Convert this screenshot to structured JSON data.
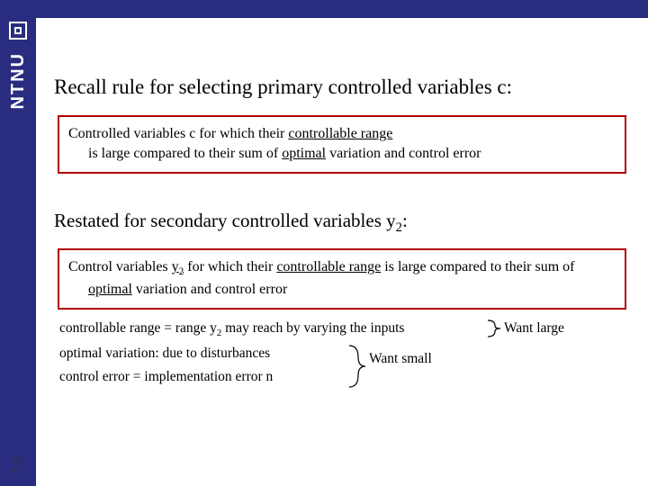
{
  "sidebar": {
    "org": "NTNU"
  },
  "slide": {
    "title_pre": "Recall rule for selecting primary controlled variables c:",
    "box1_a": "Controlled variables c for which their ",
    "box1_b": "controllable range",
    "box1_c": " is large compared to their sum of ",
    "box1_d": "optimal",
    "box1_e": " variation and control error",
    "subtitle_pre": "Restated for secondary controlled variables y",
    "subtitle_sub": "2",
    "subtitle_post": ":",
    "box2_a": "Control variables ",
    "box2_b": "y",
    "box2_bsub": "2",
    "box2_c": " for which their ",
    "box2_d": "controllable range",
    "box2_e": " is large compared to their sum of ",
    "box2_f": "optimal",
    "box2_g": " variation and control error",
    "def1_a": "controllable range = range y",
    "def1_sub": "2",
    "def1_b": " may reach by varying the inputs",
    "def2": "optimal variation: due to disturbances",
    "def3": "control error = implementation error n",
    "want_large": "Want large",
    "want_small": "Want small",
    "page_num_a": "10",
    "page_num_b": "8"
  }
}
